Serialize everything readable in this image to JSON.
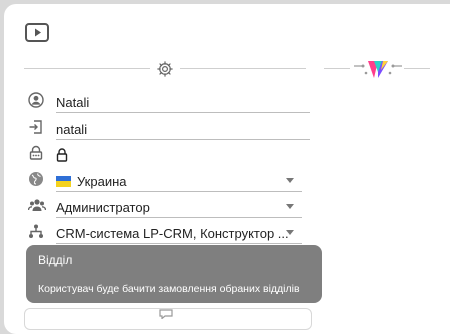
{
  "header": {
    "video_icon": "youtube-play-icon"
  },
  "tabs": [
    {
      "icon": "gear-icon"
    },
    {
      "icon": "crm-logo-icon"
    }
  ],
  "form": {
    "name_value": "Natali",
    "login_value": "natali",
    "password_value": "🔒",
    "country_value": "Украина",
    "role_value": "Администратор",
    "system_value": "CRM-система LP-CRM, Конструктор ..."
  },
  "tooltip": {
    "title": "Відділ",
    "text": "Користувач буде бачити замовлення обраних відділів"
  },
  "colors": {
    "accent_gradient": [
      "#ff3d8b",
      "#7b4dff",
      "#2ad1c9",
      "#ffd23a"
    ],
    "tooltip_bg": "#7f7f7f",
    "flag_blue": "#2f6fd6",
    "flag_yellow": "#f4d21e"
  }
}
